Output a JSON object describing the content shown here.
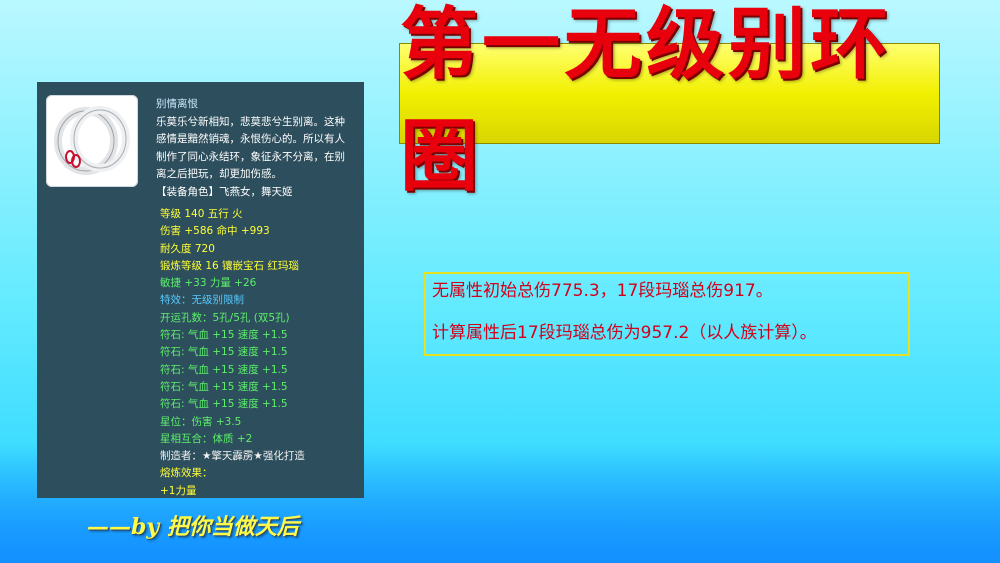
{
  "tooltip": {
    "item_name": "别情离恨",
    "description_lines": [
      "乐莫乐兮新相知，悲莫悲兮生别离。这种",
      "感情是黯然销魂，永恨伤心的。所以有人",
      "制作了同心永结环，象征永不分离，在别",
      "离之后把玩，却更加伤感。",
      "【装备角色】飞燕女，舞天姬"
    ],
    "stats": [
      {
        "text": "等级 140 五行 火",
        "color": "yellow"
      },
      {
        "text": "伤害 +586 命中 +993",
        "color": "yellow"
      },
      {
        "text": "耐久度 720",
        "color": "yellow"
      },
      {
        "text": "锻炼等级 16 镶嵌宝石 红玛瑙",
        "color": "yellow"
      },
      {
        "text": "敏捷 +33 力量 +26",
        "color": "green"
      },
      {
        "text": "特效：无级别限制",
        "color": "blue"
      },
      {
        "text": "开运孔数：5孔/5孔 (双5孔)",
        "color": "green"
      },
      {
        "text": "符石: 气血 +15 速度 +1.5",
        "color": "green"
      },
      {
        "text": "符石: 气血 +15 速度 +1.5",
        "color": "green"
      },
      {
        "text": "符石: 气血 +15 速度 +1.5",
        "color": "green"
      },
      {
        "text": "符石: 气血 +15 速度 +1.5",
        "color": "green"
      },
      {
        "text": "符石: 气血 +15 速度 +1.5",
        "color": "green"
      },
      {
        "text": "星位：伤害 +3.5",
        "color": "green"
      },
      {
        "text": "星相互合：体质 +2",
        "color": "green"
      },
      {
        "text": "制造者：★擎天霹雳★强化打造",
        "color": "white"
      },
      {
        "text": "熔炼效果：",
        "color": "yellow"
      },
      {
        "text": "+1力量",
        "color": "yellow"
      }
    ]
  },
  "title": "第一无级别环圈",
  "info": {
    "line1": "无属性初始总伤775.3，17段玛瑙总伤917。",
    "line2": "计算属性后17段玛瑙总伤为957.2（以人族计算）。"
  },
  "byline": "——by 把你当做天后",
  "colors": {
    "title_red": "#e8000d",
    "title_bg": "#f2f000",
    "info_text": "#d3001a",
    "tooltip_bg": "#2d4e5c"
  }
}
